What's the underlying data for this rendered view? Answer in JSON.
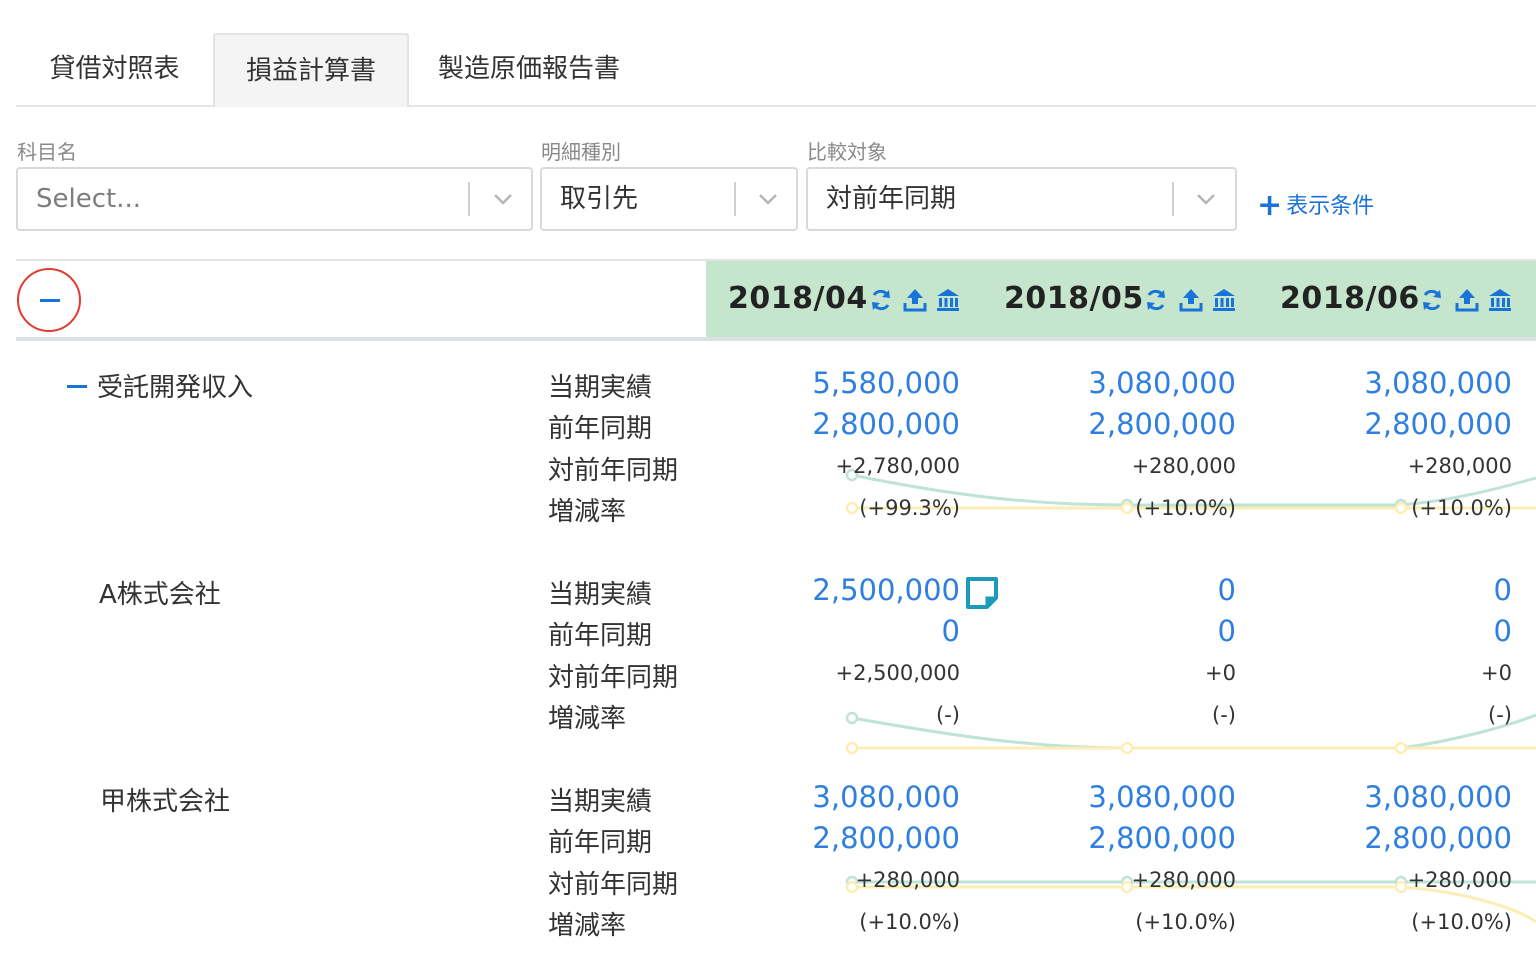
{
  "tabs": [
    {
      "label": "貸借対照表",
      "active": false
    },
    {
      "label": "損益計算書",
      "active": true
    },
    {
      "label": "製造原価報告書",
      "active": false
    }
  ],
  "filters": {
    "account": {
      "label": "科目名",
      "placeholder": "Select..."
    },
    "detail_type": {
      "label": "明細種別",
      "value": "取引先"
    },
    "compare": {
      "label": "比較対象",
      "value": "対前年同期"
    },
    "add_condition": "表示条件"
  },
  "months": [
    "2018/04",
    "2018/05",
    "2018/06"
  ],
  "row_labels": [
    "当期実績",
    "前年同期",
    "対前年同期",
    "増減率"
  ],
  "sections": [
    {
      "name": "受託開発収入",
      "actual": [
        "5,580,000",
        "3,080,000",
        "3,080,000"
      ],
      "prior": [
        "2,800,000",
        "2,800,000",
        "2,800,000"
      ],
      "diff": [
        "+2,780,000",
        "+280,000",
        "+280,000"
      ],
      "rate": [
        "(+99.3%)",
        "(+10.0%)",
        "(+10.0%)"
      ]
    },
    {
      "name": "A株式会社",
      "actual": [
        "2,500,000",
        "0",
        "0"
      ],
      "prior": [
        "0",
        "0",
        "0"
      ],
      "diff": [
        "+2,500,000",
        "+0",
        "+0"
      ],
      "rate": [
        "(-)",
        "(-)",
        "(-)"
      ]
    },
    {
      "name": "甲株式会社",
      "actual": [
        "3,080,000",
        "3,080,000",
        "3,080,000"
      ],
      "prior": [
        "2,800,000",
        "2,800,000",
        "2,800,000"
      ],
      "diff": [
        "+280,000",
        "+280,000",
        "+280,000"
      ],
      "rate": [
        "(+10.0%)",
        "(+10.0%)",
        "(+10.0%)"
      ]
    }
  ],
  "colors": {
    "header_bg": "#c5e6cc",
    "link_blue": "#2f7fe0",
    "icon_blue": "#1a73d9",
    "highlight_red": "#e23a2e",
    "spark_green": "#bfe3d6",
    "spark_yellow": "#fbeeb4",
    "note_teal": "#1d9bb8"
  }
}
